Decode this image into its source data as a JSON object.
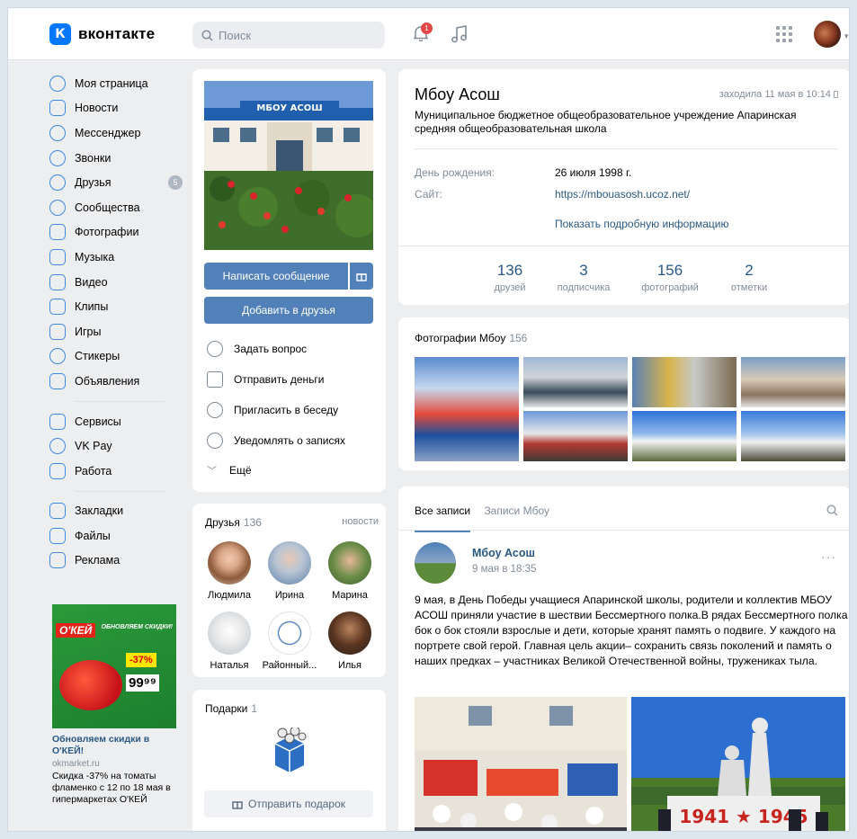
{
  "header": {
    "logo_text": "вконтакте",
    "logo_letter": "К",
    "search_placeholder": "Поиск",
    "notification_count": "1"
  },
  "left_menu": {
    "items": [
      {
        "label": "Моя страница"
      },
      {
        "label": "Новости"
      },
      {
        "label": "Мессенджер"
      },
      {
        "label": "Звонки"
      },
      {
        "label": "Друзья",
        "count": "5"
      },
      {
        "label": "Сообщества"
      },
      {
        "label": "Фотографии"
      },
      {
        "label": "Музыка"
      },
      {
        "label": "Видео"
      },
      {
        "label": "Клипы"
      },
      {
        "label": "Игры"
      },
      {
        "label": "Стикеры"
      },
      {
        "label": "Объявления"
      }
    ],
    "services": [
      {
        "label": "Сервисы"
      },
      {
        "label": "VK Pay"
      },
      {
        "label": "Работа"
      }
    ],
    "extra": [
      {
        "label": "Закладки"
      },
      {
        "label": "Файлы"
      },
      {
        "label": "Реклама"
      }
    ]
  },
  "ad": {
    "brand": "О'КЕЙ",
    "slogan": "ОБНОВЛЯЕМ СКИДКИ!",
    "discount": "-37%",
    "price": "99⁹⁹",
    "title": "Обновляем скидки в О'КЕЙ!",
    "domain": "okmarket.ru",
    "text": "Скидка -37% на томаты фламенко с 12 по 18 мая в гипермаркетах О'КЕЙ"
  },
  "profile_actions": {
    "message_button": "Написать сообщение",
    "add_friend_button": "Добавить в друзья",
    "actions": [
      {
        "label": "Задать вопрос"
      },
      {
        "label": "Отправить деньги"
      },
      {
        "label": "Пригласить в беседу"
      },
      {
        "label": "Уведомлять о записях"
      },
      {
        "label": "Ещё"
      }
    ]
  },
  "friends": {
    "title": "Друзья",
    "count": "136",
    "news_link": "новости",
    "items": [
      {
        "name": "Людмила"
      },
      {
        "name": "Ирина"
      },
      {
        "name": "Марина"
      },
      {
        "name": "Наталья"
      },
      {
        "name": "Районный..."
      },
      {
        "name": "Илья"
      }
    ]
  },
  "gifts": {
    "title": "Подарки",
    "count": "1",
    "send_button": "Отправить подарок"
  },
  "profile": {
    "name": "Мбоу Асош",
    "last_seen": "заходила 11 мая в 10:14",
    "status": "Муниципальное бюджетное общеобразовательное учреждение Апаринская средняя общеобразовательная школа",
    "birthday_label": "День рождения:",
    "birthday_value": "26 июля 1998 г.",
    "site_label": "Сайт:",
    "site_value": "https://mbouasosh.ucoz.net/",
    "more_info": "Показать подробную информацию",
    "stats": [
      {
        "number": "136",
        "label": "друзей"
      },
      {
        "number": "3",
        "label": "подписчика"
      },
      {
        "number": "156",
        "label": "фотографий"
      },
      {
        "number": "2",
        "label": "отметки"
      }
    ]
  },
  "photos": {
    "title": "Фотографии Мбоу",
    "count": "156"
  },
  "wall": {
    "tab_all": "Все записи",
    "tab_own": "Записи Мбоу",
    "post": {
      "author": "Мбоу Асош",
      "date": "9 мая в 18:35",
      "text": "9 мая, в День Победы учащиеся Апаринской школы, родители и коллектив МБОУ АСОШ приняли участие в шествии Бессмертного полка.В рядах Бессмертного полка бок о бок стояли взрослые и дети, которые хранят память о подвиге. У каждого на портрете свой герой. Главная цель акции– сохранить связь поколений и память о наших предках – участниках Великой Отечественной войны, тружениках тыла.",
      "monument_text": "1941 ★ 1945"
    }
  },
  "colors": {
    "accent": "#5181b8",
    "link": "#2a5885",
    "icon": "#3f8ae0",
    "secondary": "#818c99"
  }
}
